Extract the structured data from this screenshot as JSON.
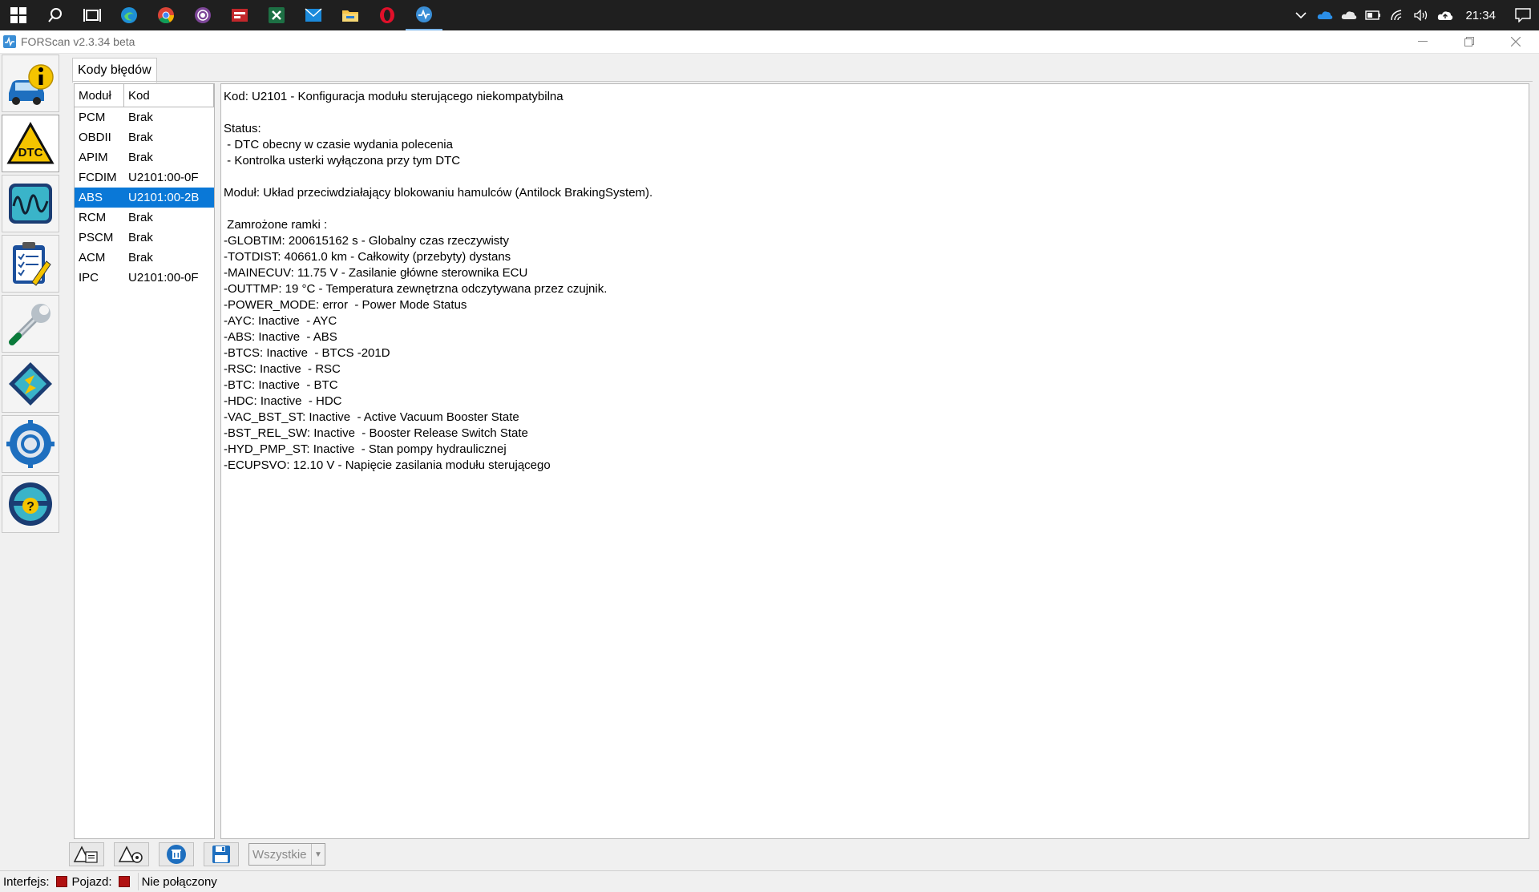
{
  "taskbar": {
    "apps": [
      "start-icon",
      "search-icon",
      "task-view-icon",
      "edge-icon",
      "chrome-icon",
      "tor-icon",
      "app-red-icon",
      "excel-icon",
      "mail-icon",
      "explorer-icon",
      "opera-icon",
      "forscan-icon"
    ],
    "clock": "21:34"
  },
  "window": {
    "title": "FORScan v2.3.34 beta"
  },
  "tab": {
    "label": "Kody błędów"
  },
  "dtc_table": {
    "headers": [
      "Moduł",
      "Kod"
    ],
    "rows": [
      {
        "module": "PCM",
        "code": "Brak"
      },
      {
        "module": "OBDII",
        "code": "Brak"
      },
      {
        "module": "APIM",
        "code": "Brak"
      },
      {
        "module": "FCDIM",
        "code": "U2101:00-0F"
      },
      {
        "module": "ABS",
        "code": "U2101:00-2B",
        "selected": true
      },
      {
        "module": "RCM",
        "code": "Brak"
      },
      {
        "module": "PSCM",
        "code": "Brak"
      },
      {
        "module": "ACM",
        "code": "Brak"
      },
      {
        "module": "IPC",
        "code": "U2101:00-0F"
      }
    ]
  },
  "detail": {
    "lines": [
      "Kod: U2101 - Konfiguracja modułu sterującego niekompatybilna",
      "",
      "Status:",
      " - DTC obecny w czasie wydania polecenia",
      " - Kontrolka usterki wyłączona przy tym DTC",
      "",
      "Moduł: Układ przeciwdziałający blokowaniu hamulców (Antilock BrakingSystem).",
      "",
      " Zamrożone ramki :",
      "-GLOBTIM: 200615162 s - Globalny czas rzeczywisty",
      "-TOTDIST: 40661.0 km - Całkowity (przebyty) dystans",
      "-MAINECUV: 11.75 V - Zasilanie główne sterownika ECU",
      "-OUTTMP: 19 °C - Temperatura zewnętrzna odczytywana przez czujnik.",
      "-POWER_MODE: error  - Power Mode Status",
      "-AYC: Inactive  - AYC",
      "-ABS: Inactive  - ABS",
      "-BTCS: Inactive  - BTCS -201D",
      "-RSC: Inactive  - RSC",
      "-BTC: Inactive  - BTC",
      "-HDC: Inactive  - HDC",
      "-VAC_BST_ST: Inactive  - Active Vacuum Booster State",
      "-BST_REL_SW: Inactive  - Booster Release Switch State",
      "-HYD_PMP_ST: Inactive  - Stan pompy hydraulicznej",
      "-ECUPSVO: 12.10 V - Napięcie zasilania modułu sterującego"
    ]
  },
  "bottombar": {
    "filter_value": "Wszystkie"
  },
  "statusbar": {
    "interface_label": "Interfejs:",
    "vehicle_label": "Pojazd:",
    "connection_status": "Nie połączony",
    "led_color": "#b01010"
  }
}
